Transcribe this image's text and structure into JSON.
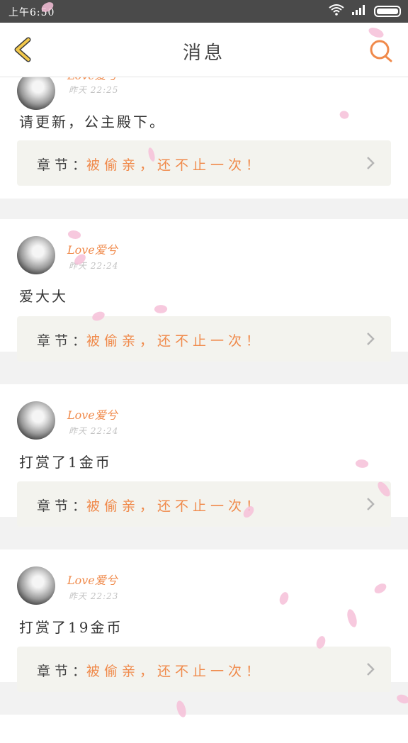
{
  "status_bar": {
    "time": "上午6:50",
    "icons": [
      "wifi-icon",
      "signal-icon",
      "battery-icon"
    ]
  },
  "header": {
    "title": "消息",
    "back_icon": "chevron-left-icon",
    "search_icon": "search-icon"
  },
  "colors": {
    "accent": "#f08a4b",
    "back_icon": "#f2c84b",
    "card_box": "#f3f3ee",
    "petal": "#f6bfd8"
  },
  "messages": [
    {
      "user": "Love爱兮",
      "time": "昨天 22:25",
      "text": "请更新，公主殿下。",
      "chapter_label": "章节：",
      "chapter_title": "被偷亲，还不止一次！"
    },
    {
      "user": "Love爱兮",
      "time": "昨天 22:24",
      "text": "爱大大",
      "chapter_label": "章节：",
      "chapter_title": "被偷亲，还不止一次！"
    },
    {
      "user": "Love爱兮",
      "time": "昨天 22:24",
      "text": "打赏了1金币",
      "chapter_label": "章节：",
      "chapter_title": "被偷亲，还不止一次！"
    },
    {
      "user": "Love爱兮",
      "time": "昨天 22:23",
      "text": "打赏了19金币",
      "chapter_label": "章节：",
      "chapter_title": "被偷亲，还不止一次！"
    }
  ]
}
